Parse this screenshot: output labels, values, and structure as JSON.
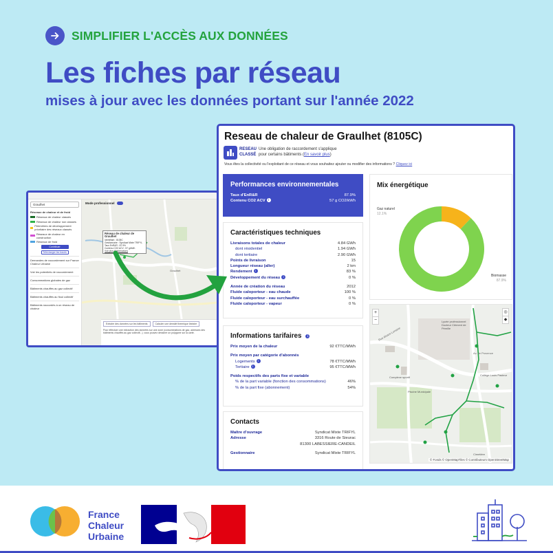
{
  "header": {
    "kicker": "SIMPLIFIER L'ACCÈS AUX DONNÉES",
    "title": "Les fiches par réseau",
    "subtitle": "mises à jour avec les données portant sur l'année 2022"
  },
  "small_screenshot": {
    "search_value": "Graulhet",
    "mode_label": "Mode professionnel",
    "legend_intro": "Réseaux de chaleur et de froid",
    "legend_items": [
      {
        "label": "Réseaux de chaleur classés",
        "color": "#1c6e2a"
      },
      {
        "label": "Réseaux de chaleur non classés",
        "color": "#2fb34b"
      },
      {
        "label": "Périmètres de développement prioritaire des réseaux classés",
        "color": "#f3c51c"
      },
      {
        "label": "Réseaux de chaleur en construction",
        "color": "#d24fd2"
      },
      {
        "label": "Réseaux de froid",
        "color": "#4fa3e0"
      }
    ],
    "contribute_label": "Contribuer",
    "download_label": "Télécharger les tracés",
    "side_sections": [
      "Demandes de raccordement sur France Chaleur Urbaine",
      "Voir les potentiels de raccordement",
      "Consommations globales de gaz",
      "Bâtiments chauffés au gaz collectif",
      "Bâtiments chauffés au fioul collectif",
      "Bâtiments raccordés à un réseau de chaleur"
    ],
    "popup": {
      "title": "Réseau de chaleur de Graulhet",
      "lines": [
        "Identifiant : 8105C",
        "Gestionnaire : Syndicat Mixte TRIFYL",
        "Taux EnR&R : 87.9%",
        "Contenu CO2 ACV : 57 g/kWh",
        "Voir plus d'informations"
      ]
    },
    "bottom_tabs": [
      "Extraire des données sur les bâtiments",
      "Calculer une densité thermique linéaire"
    ],
    "bottom_text": "Pour effectuer une extraction des données sur une zone (consommations de gaz, adresses des bâtiments chauffés au gaz collectif...), vous pouvez dessiner un polygone sur la carte."
  },
  "card": {
    "title": "Reseau de chaleur de Graulhet (8105C)",
    "badge_lines": [
      "RESEAU",
      "CLASSÉ"
    ],
    "obligation_text": "Une obligation de raccordement s'applique",
    "obligation_text2": "pour certains bâtiments (",
    "obligation_link": "En savoir plus",
    "obligation_end": ")",
    "collectivite_text": "Vous êtes la collectivité ou l'exploitant de ce réseau et vous souhaitez ajouter ou modifier des informations ?",
    "collectivite_link": "Cliquez ici",
    "performances": {
      "title": "Performances environnementales",
      "rows": [
        {
          "label": "Taux d'EnR&R",
          "value": "87.9%"
        },
        {
          "label": "Contenu CO2 ACV",
          "value": "57 g CO2/kWh"
        }
      ]
    },
    "caracteristiques": {
      "title": "Caractéristiques techniques",
      "group1": [
        {
          "label": "Livraisons totales de chaleur",
          "value": "4.84 GWh",
          "sub": false
        },
        {
          "label": "dont résidentiel",
          "value": "1.94 GWh",
          "sub": true
        },
        {
          "label": "dont tertiaire",
          "value": "2.90 GWh",
          "sub": true
        },
        {
          "label": "Points de livraison",
          "value": "15",
          "sub": false
        },
        {
          "label": "Longueur réseau (aller)",
          "value": "2 km",
          "sub": false
        },
        {
          "label": "Rendement",
          "value": "83 %",
          "sub": false
        },
        {
          "label": "Développement du réseau",
          "value": "0 %",
          "sub": false
        }
      ],
      "group2": [
        {
          "label": "Année de création du réseau",
          "value": "2012"
        },
        {
          "label": "Fluide caloporteur - eau chaude",
          "value": "100 %"
        },
        {
          "label": "Fluide caloporteur - eau surchauffée",
          "value": "0 %"
        },
        {
          "label": "Fluide caloporteur - vapeur",
          "value": "0 %"
        }
      ]
    },
    "tarifs": {
      "title": "Informations tarifaires",
      "prix_label": "Prix moyen de la chaleur",
      "prix_value": "92 €TTC/MWh",
      "cat_label": "Prix moyen par catégorie d'abonnés",
      "cat_rows": [
        {
          "label": "Logements",
          "value": "78 €TTC/MWh"
        },
        {
          "label": "Tertiaire",
          "value": "95 €TTC/MWh"
        }
      ],
      "parts_label": "Poids respectifs des parts fixe et variable",
      "parts_rows": [
        {
          "label": "% de la part variable (fonction des consommations)",
          "value": "46%"
        },
        {
          "label": "% de la part fixe (abonnement)",
          "value": "54%"
        }
      ]
    },
    "contacts": {
      "title": "Contacts",
      "moa_label": "Maître d'ouvrage",
      "moa_value": "Syndicat Mixte TRIFYL",
      "adresse_label": "Adresse",
      "adresse_line1": "3316 Route de Sieurac",
      "adresse_line2": "81300 LABESSIERE-CANDEIL",
      "gest_label": "Gestionnaire",
      "gest_value": "Syndicat Mixte TRIFYL"
    },
    "mix": {
      "title": "Mix énergétique",
      "labels": [
        {
          "name": "Gaz naturel",
          "pct": "12.1%"
        },
        {
          "name": "Biomasse",
          "pct": "87.9%"
        }
      ]
    },
    "map": {
      "attribution": "© Fonds  © OpenMapTiles  © Contributeurs OpenStreetMap",
      "labels": [
        "Rue Alsace Lorraine",
        "Lycée professionnel Docteur Clément de Pémille",
        "Av. de Provence",
        "Collège Louis Pasteur",
        "Complexe sportif",
        "Piscine Municipale",
        "Cimetière"
      ]
    }
  },
  "chart_data": {
    "type": "pie",
    "title": "Mix énergétique",
    "categories": [
      "Gaz naturel",
      "Biomasse"
    ],
    "values": [
      12.1,
      87.9
    ],
    "colors": [
      "#f6b31b",
      "#7fd34e"
    ]
  },
  "footer": {
    "brand_lines": [
      "France",
      "Chaleur",
      "Urbaine"
    ],
    "colors": {
      "primary": "#3f4cc4",
      "green": "#24a33e",
      "rf_red": "#e1000f"
    }
  }
}
